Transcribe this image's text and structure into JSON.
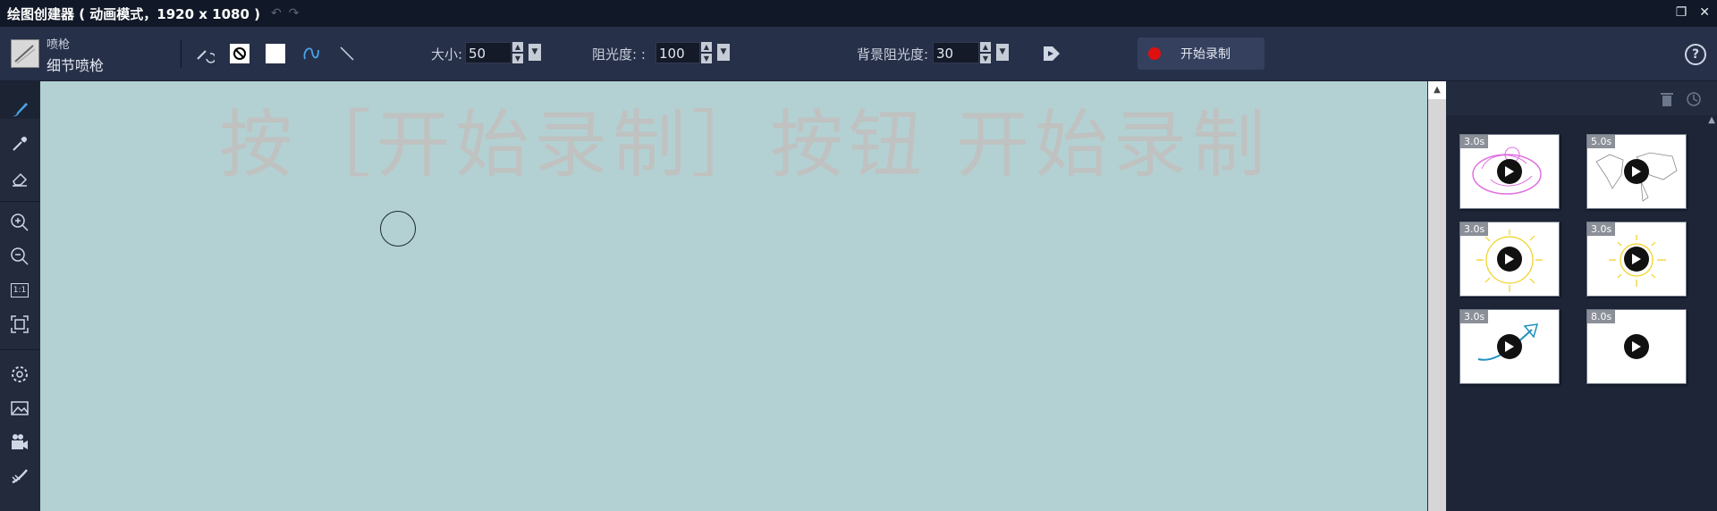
{
  "window": {
    "title": "绘图创建器 ( 动画模式，1920 x 1080 )",
    "undo_icon": "undo-icon",
    "redo_icon": "redo-icon"
  },
  "toolbar": {
    "brush_type": "喷枪",
    "brush_name": "细节喷枪",
    "size_label": "大小:",
    "size_value": "50",
    "opacity_label": "阻光度: :",
    "opacity_value": "100",
    "bg_opacity_label": "背景阻光度:",
    "bg_opacity_value": "30",
    "record_label": "开始录制",
    "record_color": "#e01010"
  },
  "canvas": {
    "watermark": "按［开始录制］按钮 开始录制",
    "background": "#b3d1d3"
  },
  "left_tools": [
    {
      "name": "brush-tool",
      "icon": "brush-icon"
    },
    {
      "name": "eyedropper-tool",
      "icon": "eyedropper-icon"
    },
    {
      "name": "eraser-tool",
      "icon": "eraser-icon"
    },
    {
      "name": "zoom-in-tool",
      "icon": "zoom-in-icon"
    },
    {
      "name": "zoom-out-tool",
      "icon": "zoom-out-icon"
    },
    {
      "name": "actual-size-tool",
      "icon": "actual-size-icon",
      "text": "1:1"
    },
    {
      "name": "fit-tool",
      "icon": "fit-screen-icon"
    },
    {
      "name": "settings-tool",
      "icon": "gear-icon"
    },
    {
      "name": "image-tool",
      "icon": "image-icon"
    },
    {
      "name": "camera-tool",
      "icon": "video-camera-icon"
    },
    {
      "name": "clear-tool",
      "icon": "clear-brush-icon"
    }
  ],
  "templates": [
    {
      "duration": "3.0s",
      "sketch": "pink-scribble"
    },
    {
      "duration": "5.0s",
      "sketch": "world-map"
    },
    {
      "duration": "3.0s",
      "sketch": "yellow-sun"
    },
    {
      "duration": "3.0s",
      "sketch": "yellow-sun-small"
    },
    {
      "duration": "3.0s",
      "sketch": "blue-arrow"
    },
    {
      "duration": "8.0s",
      "sketch": "blank"
    }
  ]
}
